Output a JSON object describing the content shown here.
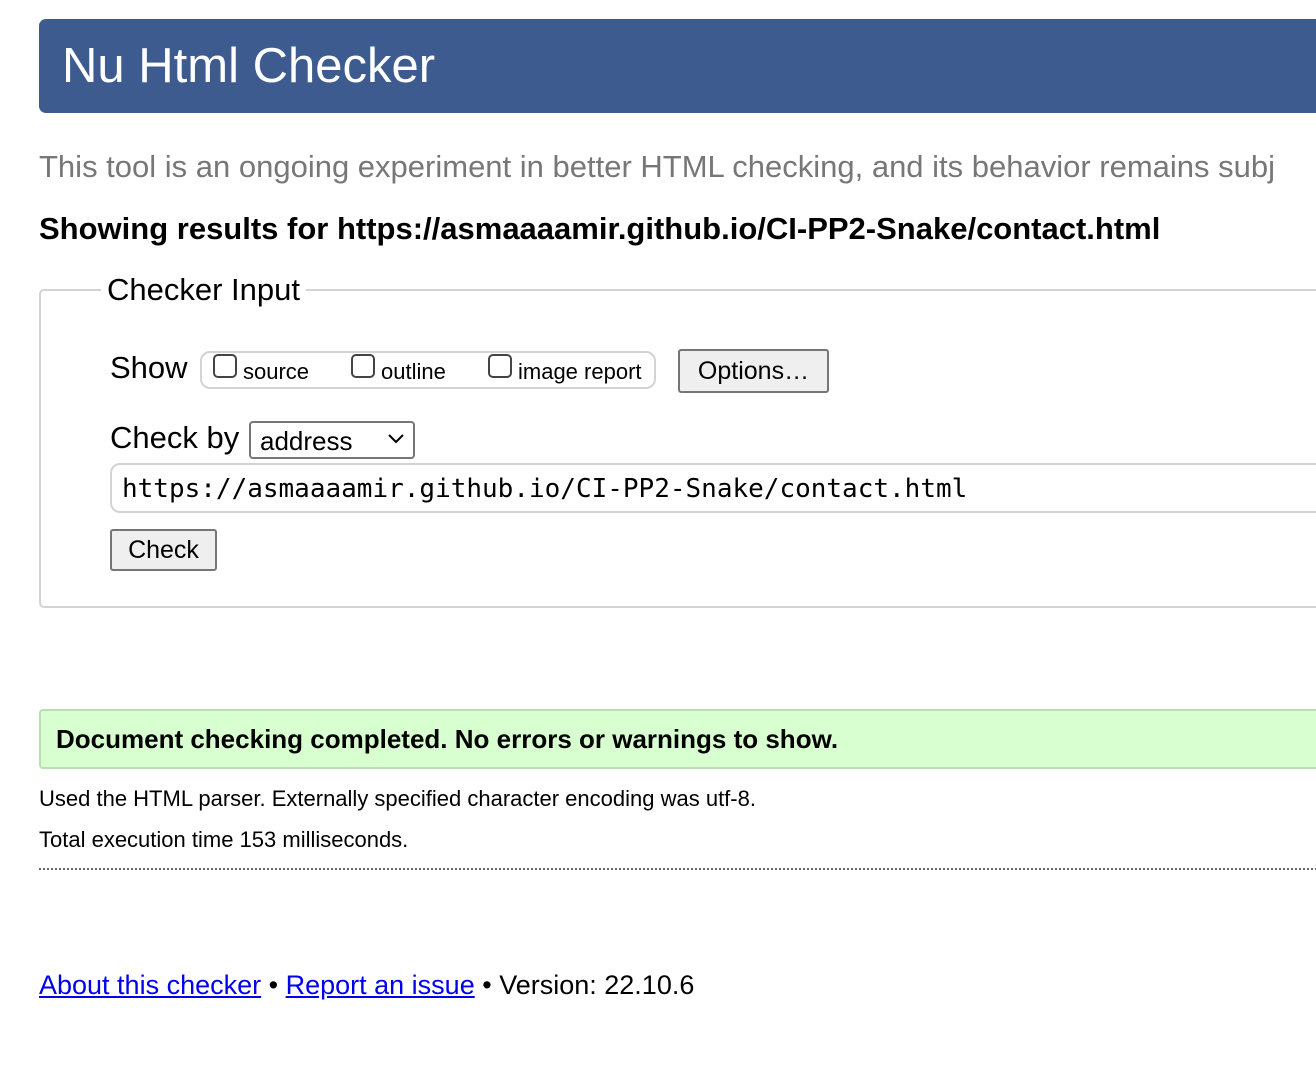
{
  "header": {
    "title": "Nu Html Checker"
  },
  "intro": {
    "text": "This tool is an ongoing experiment in better HTML checking, and its behavior remains subj"
  },
  "results": {
    "heading": "Showing results for https://asmaaaamir.github.io/CI-PP2-Snake/contact.html"
  },
  "checker_input": {
    "legend": "Checker Input",
    "show_label": "Show",
    "options": [
      {
        "label": "source",
        "checked": false
      },
      {
        "label": "outline",
        "checked": false
      },
      {
        "label": "image report",
        "checked": false
      }
    ],
    "options_button": "Options…",
    "check_by_label": "Check by",
    "check_by_selected": "address",
    "url_value": "https://asmaaaamir.github.io/CI-PP2-Snake/contact.html",
    "check_button": "Check"
  },
  "status": {
    "message": "Document checking completed. No errors or warnings to show.",
    "color": "#d8ffd0"
  },
  "info": {
    "parser": "Used the HTML parser. Externally specified character encoding was utf-8.",
    "time": "Total execution time 153 milliseconds."
  },
  "footer": {
    "about_link": "About this checker",
    "separator": "•",
    "report_link": "Report an issue",
    "version_text": "Version: 22.10.6"
  },
  "colors": {
    "header_bg": "#3e5b8f",
    "link": "#0000ee",
    "muted_text": "#777777"
  }
}
